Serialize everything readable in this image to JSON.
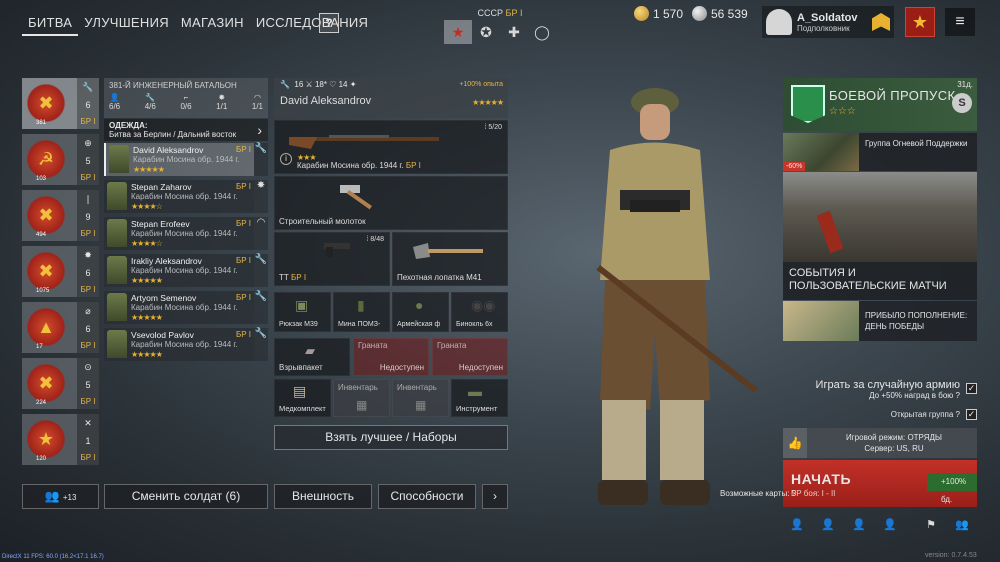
{
  "nav": {
    "tabs": [
      "БИТВА",
      "УЛУЧШЕНИЯ",
      "МАГАЗИН",
      "ИССЛЕДОВАНИЯ"
    ],
    "help": "?"
  },
  "faction": {
    "country": "СССР",
    "br": "БР I"
  },
  "currency": {
    "gold": "1 570",
    "silver": "56 539"
  },
  "profile": {
    "name": "A_Soldatov",
    "rank": "Подполковник"
  },
  "squads": [
    {
      "num": "381",
      "count": "6",
      "br": "БР I"
    },
    {
      "num": "103",
      "count": "5",
      "br": "БР I"
    },
    {
      "num": "494",
      "count": "9",
      "br": "БР I"
    },
    {
      "num": "1075",
      "count": "6",
      "br": "БР I"
    },
    {
      "num": "17",
      "count": "6",
      "br": "БР I"
    },
    {
      "num": "224",
      "count": "5",
      "br": "БР I"
    },
    {
      "num": "120",
      "count": "1",
      "br": "БР I"
    }
  ],
  "battalion": {
    "title": "381-Й ИНЖЕНЕРНЫЙ БАТАЛЬОН",
    "stats": [
      "6/6",
      "4/6",
      "0/6",
      "1/1",
      "1/1"
    ]
  },
  "outfit": {
    "label": "ОДЕЖДА:",
    "value": "Битва за Берлин / Дальний восток"
  },
  "soldiers": [
    {
      "name": "David Aleksandrov",
      "weapon": "Карабин Мосина обр. 1944 г.",
      "br": "БР I",
      "stars": "★★★★★"
    },
    {
      "name": "Stepan Zaharov",
      "weapon": "Карабин Мосина обр. 1944 г.",
      "br": "БР I",
      "stars": "★★★★☆"
    },
    {
      "name": "Stepan Erofeev",
      "weapon": "Карабин Мосина обр. 1944 г.",
      "br": "БР I",
      "stars": "★★★★☆"
    },
    {
      "name": "Irakliy Aleksandrov",
      "weapon": "Карабин Мосина обр. 1944 г.",
      "br": "БР I",
      "stars": "★★★★★"
    },
    {
      "name": "Artyom Semenov",
      "weapon": "Карабин Мосина обр. 1944 г.",
      "br": "БР I",
      "stars": "★★★★★"
    },
    {
      "name": "Vsevolod Pavlov",
      "weapon": "Карабин Мосина обр. 1944 г.",
      "br": "БР I",
      "stars": "★★★★★"
    }
  ],
  "loadout": {
    "head_stats": [
      "16",
      "18*",
      "14"
    ],
    "exp": "+100% опыта",
    "soldier_name": "David Aleksandrov",
    "stars": "★★★★★",
    "primary": {
      "label": "Карабин Мосина обр. 1944 г.",
      "br": "БР I",
      "ammo": "5/20",
      "stars": "★★★"
    },
    "melee": "Строительный молоток",
    "sidearm": {
      "label": "ТТ",
      "br": "БР I",
      "ammo": "8/48"
    },
    "shovel": "Пехотная лопатка М41",
    "items": [
      "Рюкзак М39",
      "Мина ПОМЗ-",
      "Армейская ф",
      "Бинокль 6х"
    ],
    "explosive": "Взрывпакет",
    "grenade_label": "Граната",
    "unavailable": "Недоступен",
    "medkit": "Медкомплект",
    "inventory": "Инвентарь",
    "tool": "Инструмент",
    "best_button": "Взять лучшее / Наборы"
  },
  "bottom": {
    "squad_count": "+13",
    "change_soldier": "Сменить солдат (6)",
    "appearance": "Внешность",
    "abilities": "Способности",
    "next": "›"
  },
  "right": {
    "bp_title": "БОЕВОЙ ПРОПУСК",
    "bp_days": "31д.",
    "bp_stars": "☆☆☆",
    "bp_s": "S",
    "promo1_discount": "-60%",
    "promo1_text": "Группа Огневой Поддержки",
    "events": "СОБЫТИЯ И ПОЛЬЗОВАТЕЛЬСКИЕ МАТЧИ",
    "promo2_text": "ПРИБЫЛО ПОПОЛНЕНИЕ: ДЕНЬ ПОБЕДЫ",
    "random_army": "Играть за случайную армию",
    "random_army_sub": "До +50% наград в бою",
    "open_group": "Открытая группа",
    "mode": "Игровой режим: ОТРЯДЫ",
    "server": "Сервер: US, RU",
    "start": "НАЧАТЬ",
    "start_br": "БР боя: I - II",
    "xp_bonus": "+100% бд.",
    "maps_label": "Возможные карты:"
  },
  "footer": {
    "fps": "DirectX 11 FPS: 60.0 (16.2<17.1 16.7)",
    "version": "version: 0.7.4.53"
  }
}
